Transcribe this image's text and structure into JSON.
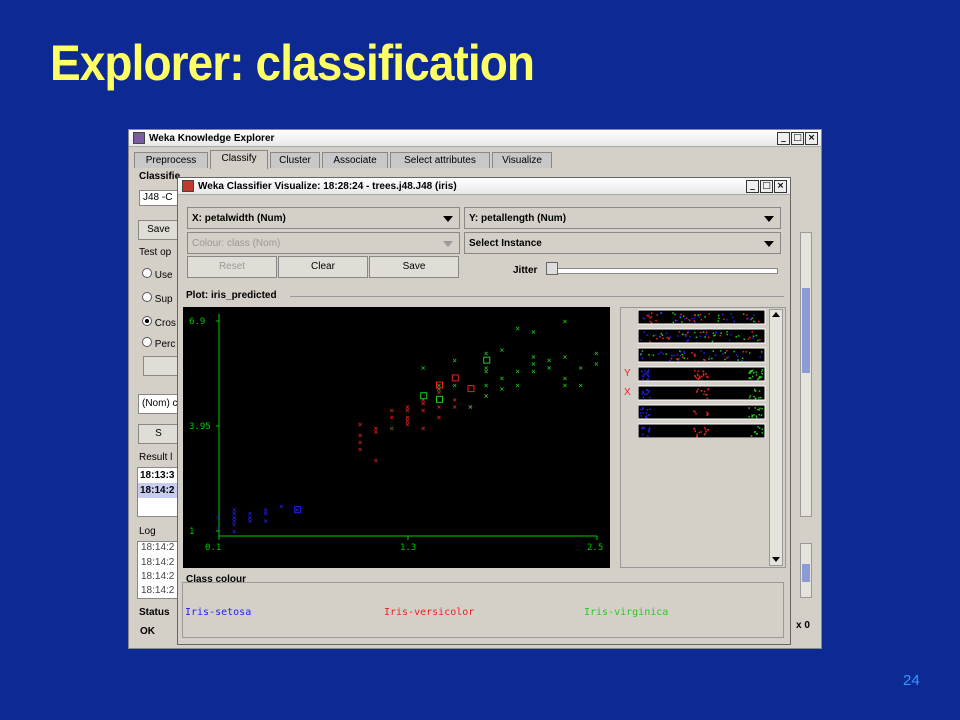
{
  "slide": {
    "title": "Explorer: classification",
    "page_number": "24"
  },
  "explorer": {
    "title": "Weka Knowledge Explorer",
    "tabs": [
      {
        "label": "Preprocess"
      },
      {
        "label": "Classify"
      },
      {
        "label": "Cluster"
      },
      {
        "label": "Associate"
      },
      {
        "label": "Select attributes"
      },
      {
        "label": "Visualize"
      }
    ],
    "active_tab": "Classify",
    "fragments": {
      "classifier_label": "Classifie",
      "classifier_value": "J48 -C",
      "save_btn": "Save",
      "test_options": "Test op",
      "opt_use": "Use",
      "opt_sup": "Sup",
      "opt_cros": "Cros",
      "opt_perc": "Perc",
      "nom": "(Nom) c",
      "start": "S",
      "result_list": "Result l",
      "result_1": "18:13:3",
      "result_2": "18:14:2",
      "log_label": "Log",
      "log_lines": [
        "18:14:2",
        "18:14:2",
        "18:14:2",
        "18:14:2"
      ],
      "status_label": "Status",
      "status_value": "OK",
      "x0": "x 0"
    }
  },
  "visualizer": {
    "title": "Weka Classifier Visualize: 18:28:24 - trees.j48.J48 (iris)",
    "x_select": "X: petalwidth (Num)",
    "y_select": "Y: petallength (Num)",
    "colour_select": "Colour: class (Nom)",
    "instance_select": "Select Instance",
    "buttons": {
      "reset": "Reset",
      "clear": "Clear",
      "save": "Save"
    },
    "jitter_label": "Jitter",
    "plot_label": "Plot: iris_predicted",
    "class_colour_label": "Class colour",
    "classes": [
      {
        "name": "Iris-setosa",
        "color": "#2222ee"
      },
      {
        "name": "Iris-versicolor",
        "color": "#ee2222"
      },
      {
        "name": "Iris-virginica",
        "color": "#22cc22"
      }
    ],
    "strip_markers": {
      "y": "Y",
      "x": "X"
    }
  },
  "chart_data": {
    "type": "scatter",
    "title": "Plot: iris_predicted",
    "xlabel": "petalwidth",
    "ylabel": "petallength",
    "xlim": [
      0.1,
      2.5
    ],
    "ylim": [
      1,
      6.9
    ],
    "x_ticks": [
      "0.1",
      "1.3",
      "2.5"
    ],
    "y_ticks": [
      "6.9",
      "3.95",
      "1"
    ],
    "series": [
      {
        "name": "Iris-setosa",
        "color": "#2222ee",
        "x": [
          0.1,
          0.1,
          0.2,
          0.2,
          0.2,
          0.2,
          0.2,
          0.2,
          0.3,
          0.3,
          0.3,
          0.4,
          0.4,
          0.4,
          0.5,
          0.6
        ],
        "y": [
          1.1,
          1.4,
          1.0,
          1.2,
          1.3,
          1.4,
          1.5,
          1.6,
          1.3,
          1.4,
          1.5,
          1.3,
          1.5,
          1.6,
          1.7,
          1.6
        ]
      },
      {
        "name": "Iris-versicolor",
        "color": "#ee2222",
        "x": [
          1.0,
          1.0,
          1.0,
          1.0,
          1.1,
          1.1,
          1.1,
          1.2,
          1.2,
          1.2,
          1.3,
          1.3,
          1.3,
          1.3,
          1.3,
          1.4,
          1.4,
          1.4,
          1.4,
          1.5,
          1.5,
          1.5,
          1.6,
          1.6,
          1.7,
          1.8
        ],
        "y": [
          3.3,
          3.5,
          3.7,
          4.0,
          3.0,
          3.8,
          3.9,
          3.9,
          4.2,
          4.4,
          4.0,
          4.1,
          4.2,
          4.4,
          4.5,
          3.9,
          4.4,
          4.6,
          4.7,
          4.2,
          4.5,
          4.9,
          4.5,
          4.7,
          4.5,
          4.8
        ]
      },
      {
        "name": "Iris-virginica",
        "color": "#22cc22",
        "x": [
          1.4,
          1.5,
          1.5,
          1.6,
          1.6,
          1.7,
          1.8,
          1.8,
          1.8,
          1.8,
          1.8,
          1.9,
          1.9,
          1.9,
          2.0,
          2.0,
          2.0,
          2.1,
          2.1,
          2.1,
          2.1,
          2.2,
          2.2,
          2.3,
          2.3,
          2.3,
          2.3,
          2.4,
          2.4,
          2.5,
          2.5
        ],
        "y": [
          5.6,
          5.0,
          5.1,
          5.8,
          5.1,
          4.5,
          4.8,
          5.1,
          5.5,
          5.6,
          6.0,
          5.0,
          5.3,
          6.1,
          5.1,
          5.5,
          6.7,
          5.5,
          5.7,
          5.9,
          6.6,
          5.6,
          5.8,
          5.1,
          5.3,
          5.9,
          6.9,
          5.1,
          5.6,
          5.7,
          6.0
        ]
      }
    ],
    "marker": "x (correct) / square (misclassified)"
  }
}
